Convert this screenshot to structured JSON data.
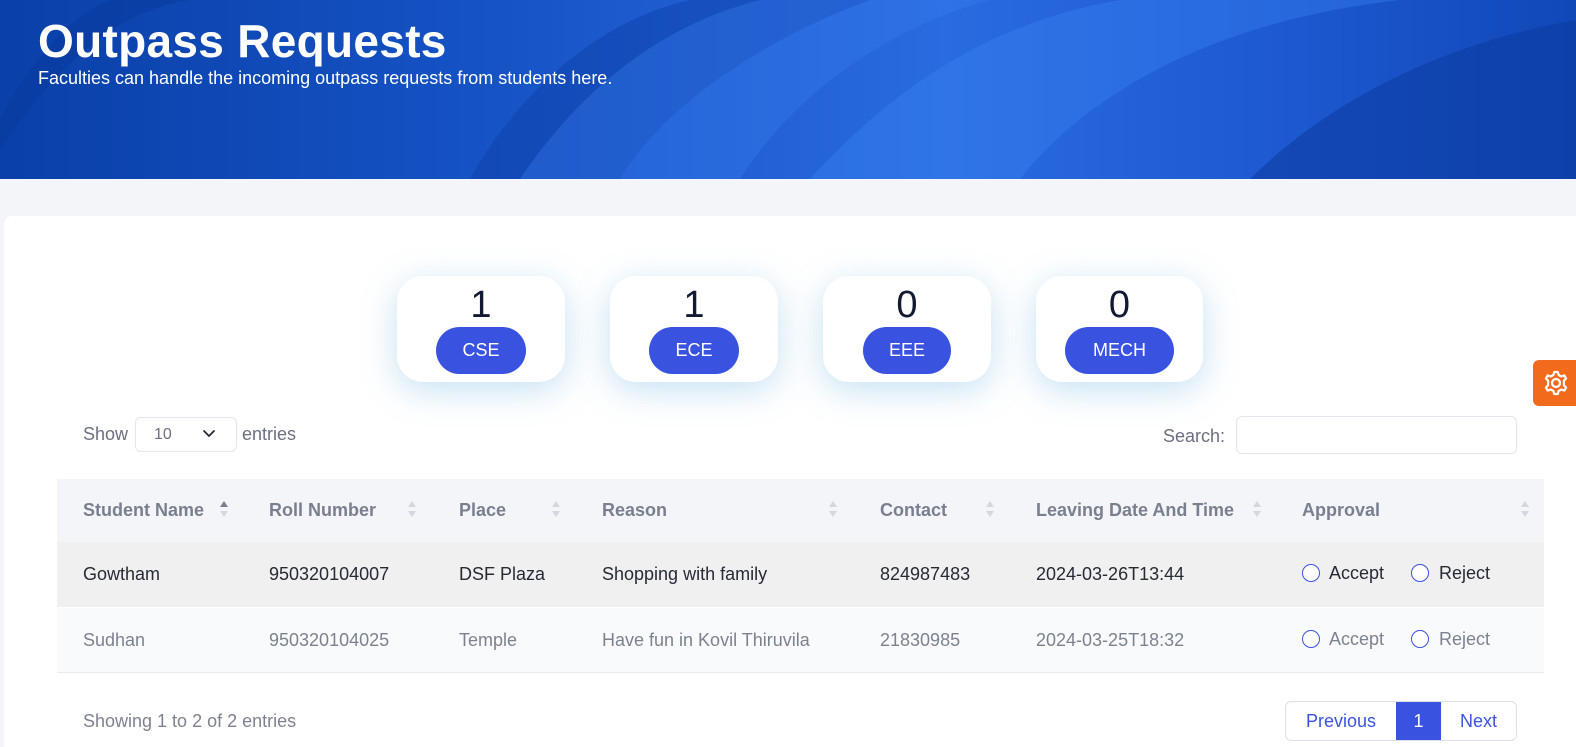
{
  "header": {
    "title": "Outpass Requests",
    "subtitle": "Faculties can handle the incoming outpass requests from students here."
  },
  "stats": [
    {
      "count": "1",
      "department": "CSE"
    },
    {
      "count": "1",
      "department": "ECE"
    },
    {
      "count": "0",
      "department": "EEE"
    },
    {
      "count": "0",
      "department": "MECH"
    }
  ],
  "settings": {
    "icon": "gear-icon"
  },
  "table_controls": {
    "show_label": "Show",
    "length_value": "10",
    "entries_label": "entries",
    "search_label": "Search:",
    "search_value": ""
  },
  "table": {
    "columns": [
      "Student Name",
      "Roll Number",
      "Place",
      "Reason",
      "Contact",
      "Leaving Date And Time",
      "Approval"
    ],
    "sorted_column": "Student Name",
    "rows": [
      {
        "name": "Gowtham",
        "roll": "950320104007",
        "place": "DSF Plaza",
        "reason": "Shopping with family",
        "contact": "824987483",
        "leaving": "2024-03-26T13:44",
        "accept": "Accept",
        "reject": "Reject"
      },
      {
        "name": "Sudhan",
        "roll": "950320104025",
        "place": "Temple",
        "reason": "Have fun in Kovil Thiruvila",
        "contact": "21830985",
        "leaving": "2024-03-25T18:32",
        "accept": "Accept",
        "reject": "Reject"
      }
    ]
  },
  "footer": {
    "info": "Showing 1 to 2 of 2 entries",
    "previous": "Previous",
    "current_page": "1",
    "next": "Next"
  },
  "colors": {
    "accent": "#3a52e0",
    "settings_tab": "#f26b1d",
    "header_blue": "#1552c4"
  }
}
